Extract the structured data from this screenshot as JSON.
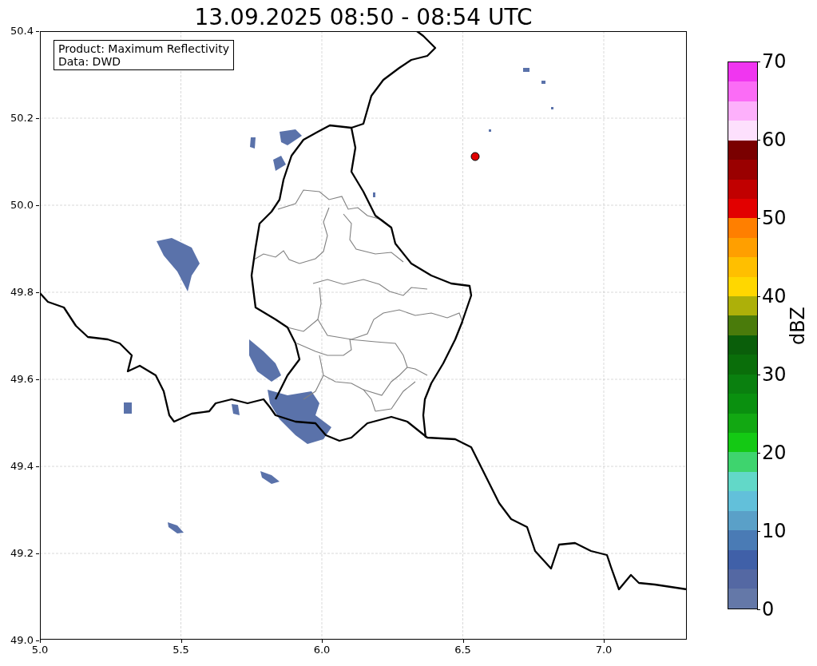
{
  "title": "13.09.2025 08:50 - 08:54 UTC",
  "legend": {
    "lines": [
      "Product: Maximum Reflectivity",
      "Data: DWD"
    ]
  },
  "map": {
    "xticks": [
      "5.0",
      "5.5",
      "6.0",
      "6.5",
      "7.0"
    ],
    "yticks": [
      "50.4",
      "50.2",
      "50.0",
      "49.8",
      "49.6",
      "49.4",
      "49.2",
      "49.0"
    ]
  },
  "colorbar": {
    "label": "dBZ",
    "ticks": [
      "70",
      "60",
      "50",
      "40",
      "30",
      "20",
      "10",
      "0"
    ],
    "segments": [
      {
        "color": "#f036f0"
      },
      {
        "color": "#fb6cf6"
      },
      {
        "color": "#fdb0fb"
      },
      {
        "color": "#fde0fd"
      },
      {
        "color": "#7a0000"
      },
      {
        "color": "#9a0000"
      },
      {
        "color": "#c10000"
      },
      {
        "color": "#e20000"
      },
      {
        "color": "#ff7f00"
      },
      {
        "color": "#ff9f00"
      },
      {
        "color": "#ffbf00"
      },
      {
        "color": "#ffd700"
      },
      {
        "color": "#adb009"
      },
      {
        "color": "#4a7b0b"
      },
      {
        "color": "#0a5e0a"
      },
      {
        "color": "#0a6e0a"
      },
      {
        "color": "#0a800f"
      },
      {
        "color": "#0a900f"
      },
      {
        "color": "#12a812"
      },
      {
        "color": "#14c914"
      },
      {
        "color": "#3ed46e"
      },
      {
        "color": "#62d8c8"
      },
      {
        "color": "#62c0da"
      },
      {
        "color": "#5aa0c8"
      },
      {
        "color": "#4a7bb5"
      },
      {
        "color": "#4060a8"
      },
      {
        "color": "#5468a3"
      },
      {
        "color": "#6478a8"
      }
    ]
  }
}
